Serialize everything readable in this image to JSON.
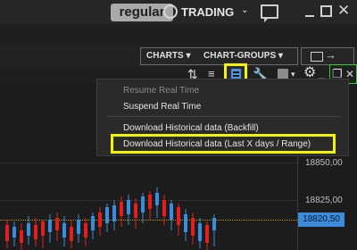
{
  "topbar": {
    "mode": "regular",
    "trading_label": "TRADING",
    "trading_chevron": "⌄",
    "close_glyph": "✕"
  },
  "tabbar": {
    "charts_label": "CHARTS ▾",
    "chart_groups_label": "CHART-GROUPS ▾"
  },
  "toolbar": {
    "icons": [
      "sort-arrows-icon",
      "sort-descending-icon",
      "data-download-icon",
      "wrench-icon",
      "color-square-icon",
      "gear-icon",
      "minimize-icon",
      "restore-icon"
    ],
    "highlight_color": "#f4f400"
  },
  "menu": {
    "items": [
      {
        "label": "Resume Real Time",
        "enabled": false
      },
      {
        "label": "Suspend Real Time",
        "enabled": true
      },
      {
        "label": "Download Historical data (Backfill)",
        "enabled": true
      },
      {
        "label": "Download Historical data (Last X days / Range)",
        "enabled": true,
        "highlighted": true
      }
    ]
  },
  "chart": {
    "price_labels": [
      "18850,00",
      "18825,00"
    ],
    "current_price": "18820,50",
    "up_color": "#3b8ddc",
    "down_color": "#e02020"
  }
}
